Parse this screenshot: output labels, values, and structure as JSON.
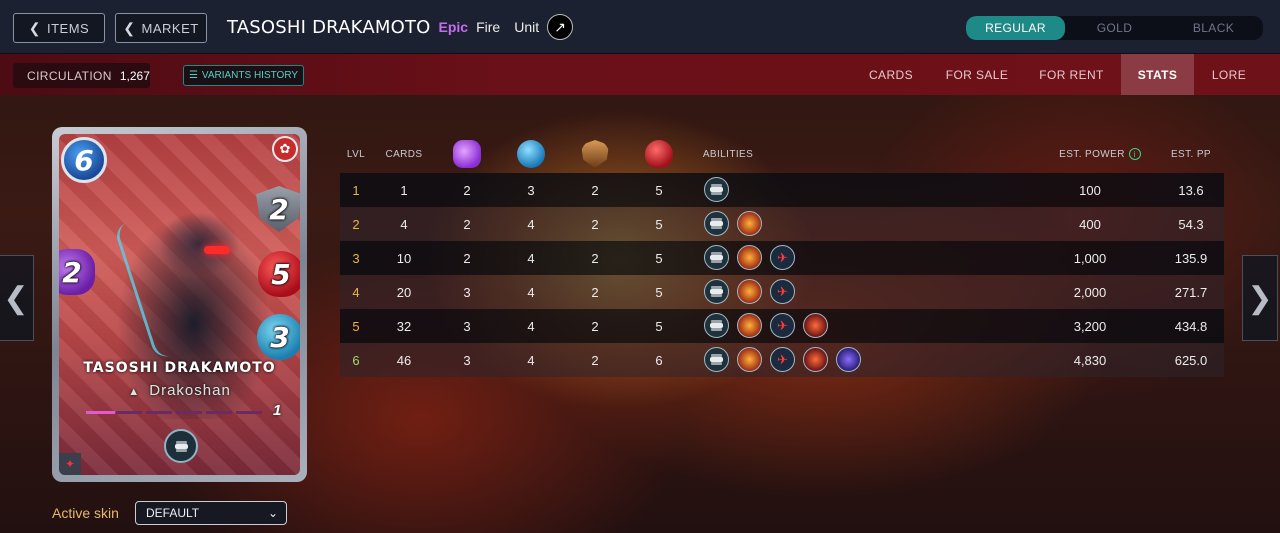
{
  "nav": {
    "items_label": "ITEMS",
    "market_label": "MARKET"
  },
  "card": {
    "name": "TASOSHI DRAKAMOTO",
    "rarity": "Epic",
    "element": "Fire",
    "type": "Unit",
    "mana": "6",
    "armor": "2",
    "health": "5",
    "speed": "3",
    "magic": "2",
    "tribe": "Drakoshan",
    "level": "1",
    "level_progress": 0.16
  },
  "editions": [
    "REGULAR",
    "GOLD",
    "BLACK"
  ],
  "editions_active": "REGULAR",
  "circulation": {
    "label": "CIRCULATION",
    "value": "1,267"
  },
  "variants_label": "VARIANTS HISTORY",
  "tabs": [
    "CARDS",
    "FOR SALE",
    "FOR RENT",
    "STATS",
    "LORE"
  ],
  "tabs_active": "STATS",
  "skin": {
    "label": "Active skin",
    "value": "DEFAULT"
  },
  "table": {
    "headers": {
      "lvl": "LVL",
      "cards": "CARDS",
      "abilities": "ABILITIES",
      "power": "EST. POWER",
      "pp": "EST. PP"
    },
    "rows": [
      {
        "lvl": "1",
        "cards": "1",
        "magic": "2",
        "speed": "3",
        "armor": "2",
        "health": "5",
        "abilities": 1,
        "power": "100",
        "pp": "13.6"
      },
      {
        "lvl": "2",
        "cards": "4",
        "magic": "2",
        "speed": "4",
        "armor": "2",
        "health": "5",
        "abilities": 2,
        "power": "400",
        "pp": "54.3"
      },
      {
        "lvl": "3",
        "cards": "10",
        "magic": "2",
        "speed": "4",
        "armor": "2",
        "health": "5",
        "abilities": 3,
        "power": "1,000",
        "pp": "135.9"
      },
      {
        "lvl": "4",
        "cards": "20",
        "magic": "3",
        "speed": "4",
        "armor": "2",
        "health": "5",
        "abilities": 3,
        "power": "2,000",
        "pp": "271.7"
      },
      {
        "lvl": "5",
        "cards": "32",
        "magic": "3",
        "speed": "4",
        "armor": "2",
        "health": "5",
        "abilities": 4,
        "power": "3,200",
        "pp": "434.8"
      },
      {
        "lvl": "6",
        "cards": "46",
        "magic": "3",
        "speed": "4",
        "armor": "2",
        "health": "6",
        "abilities": 5,
        "power": "4,830",
        "pp": "625.0"
      }
    ]
  }
}
